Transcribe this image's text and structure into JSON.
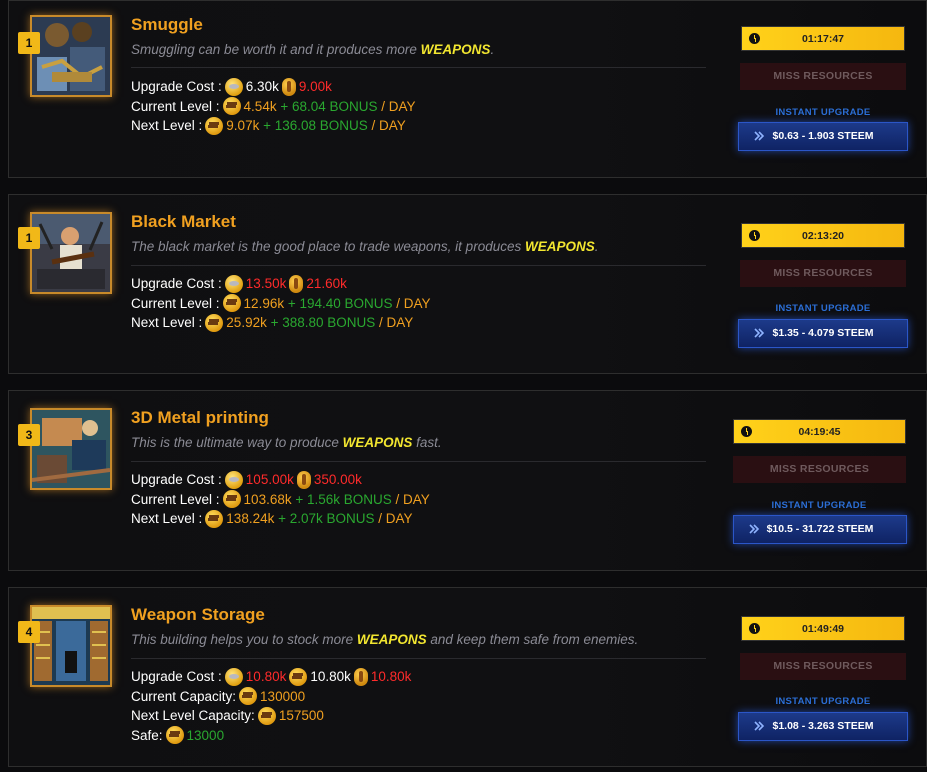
{
  "buildings": [
    {
      "level": "1",
      "title": "Smuggle",
      "desc_pre": "Smuggling can be worth it and it produces more ",
      "desc_hl": "WEAPONS",
      "desc_post": ".",
      "timer": "01:17:47",
      "miss": "MISS RESOURCES",
      "instant": "INSTANT UPGRADE",
      "price": "$0.63 - 1.903 STEEM",
      "rows": [
        {
          "label": "Upgrade Cost : ",
          "parts": [
            {
              "icon": "coin-icon"
            },
            {
              "t": "6.30k",
              "c": "wht"
            },
            {
              "icon": "bottle-icon"
            },
            {
              "t": "9.00k",
              "c": "red"
            }
          ]
        },
        {
          "label": "Current Level : ",
          "parts": [
            {
              "icon": "gun-icon"
            },
            {
              "t": "4.54k",
              "c": "org"
            },
            {
              "t": " + 68.04 BONUS",
              "c": "grn"
            },
            {
              "t": " / DAY",
              "c": "org"
            }
          ]
        },
        {
          "label": "Next Level : ",
          "parts": [
            {
              "icon": "gun-icon"
            },
            {
              "t": "9.07k",
              "c": "org"
            },
            {
              "t": " + 136.08 BONUS",
              "c": "grn"
            },
            {
              "t": " / DAY",
              "c": "org"
            }
          ]
        }
      ]
    },
    {
      "level": "1",
      "title": "Black Market",
      "desc_pre": "The black market is the good place to trade weapons, it produces ",
      "desc_hl": "WEAPONS",
      "desc_post": ".",
      "timer": "02:13:20",
      "miss": "MISS RESOURCES",
      "instant": "INSTANT UPGRADE",
      "price": "$1.35 - 4.079 STEEM",
      "rows": [
        {
          "label": "Upgrade Cost : ",
          "parts": [
            {
              "icon": "coin-icon"
            },
            {
              "t": "13.50k",
              "c": "red"
            },
            {
              "icon": "bottle-icon"
            },
            {
              "t": "21.60k",
              "c": "red"
            }
          ]
        },
        {
          "label": "Current Level : ",
          "parts": [
            {
              "icon": "gun-icon"
            },
            {
              "t": "12.96k",
              "c": "org"
            },
            {
              "t": " + 194.40 BONUS",
              "c": "grn"
            },
            {
              "t": " / DAY",
              "c": "org"
            }
          ]
        },
        {
          "label": "Next Level : ",
          "parts": [
            {
              "icon": "gun-icon"
            },
            {
              "t": "25.92k",
              "c": "org"
            },
            {
              "t": " + 388.80 BONUS",
              "c": "grn"
            },
            {
              "t": " / DAY",
              "c": "org"
            }
          ]
        }
      ]
    },
    {
      "level": "3",
      "title": "3D Metal printing",
      "desc_pre": "This is the ultimate way to produce ",
      "desc_hl": "WEAPONS",
      "desc_post": " fast.",
      "timer": "04:19:45",
      "miss": "MISS RESOURCES",
      "instant": "INSTANT UPGRADE",
      "price": "$10.5 - 31.722 STEEM",
      "rows": [
        {
          "label": "Upgrade Cost : ",
          "parts": [
            {
              "icon": "coin-icon"
            },
            {
              "t": "105.00k",
              "c": "red"
            },
            {
              "icon": "bottle-icon"
            },
            {
              "t": "350.00k",
              "c": "red"
            }
          ]
        },
        {
          "label": "Current Level : ",
          "parts": [
            {
              "icon": "gun-icon"
            },
            {
              "t": "103.68k",
              "c": "org"
            },
            {
              "t": " + 1.56k BONUS",
              "c": "grn"
            },
            {
              "t": " / DAY",
              "c": "org"
            }
          ]
        },
        {
          "label": "Next Level : ",
          "parts": [
            {
              "icon": "gun-icon"
            },
            {
              "t": "138.24k",
              "c": "org"
            },
            {
              "t": " + 2.07k BONUS",
              "c": "grn"
            },
            {
              "t": " / DAY",
              "c": "org"
            }
          ]
        }
      ]
    },
    {
      "level": "4",
      "title": "Weapon Storage",
      "desc_pre": "This building helps you to stock more ",
      "desc_hl": "WEAPONS",
      "desc_post": " and keep them safe from enemies.",
      "timer": "01:49:49",
      "miss": "MISS RESOURCES",
      "instant": "INSTANT UPGRADE",
      "price": "$1.08 - 3.263 STEEM",
      "rows": [
        {
          "label": "Upgrade Cost : ",
          "parts": [
            {
              "icon": "coin-icon"
            },
            {
              "t": "10.80k",
              "c": "red"
            },
            {
              "icon": "gun-icon"
            },
            {
              "t": "10.80k",
              "c": "wht"
            },
            {
              "icon": "bottle-icon"
            },
            {
              "t": "10.80k",
              "c": "red"
            }
          ]
        },
        {
          "label": "Current Capacity: ",
          "parts": [
            {
              "icon": "gun-icon"
            },
            {
              "t": "130000",
              "c": "org"
            }
          ]
        },
        {
          "label": "Next Level Capacity: ",
          "parts": [
            {
              "icon": "gun-icon"
            },
            {
              "t": "157500",
              "c": "org"
            }
          ]
        },
        {
          "label": "Safe: ",
          "parts": [
            {
              "icon": "gun-icon"
            },
            {
              "t": "13000",
              "c": "grn"
            }
          ]
        }
      ]
    }
  ],
  "colors": {
    "title": "#f0a020",
    "highlight": "#f2e630",
    "timer": "#ffd21a",
    "steem_button": "#1d3a8a"
  }
}
